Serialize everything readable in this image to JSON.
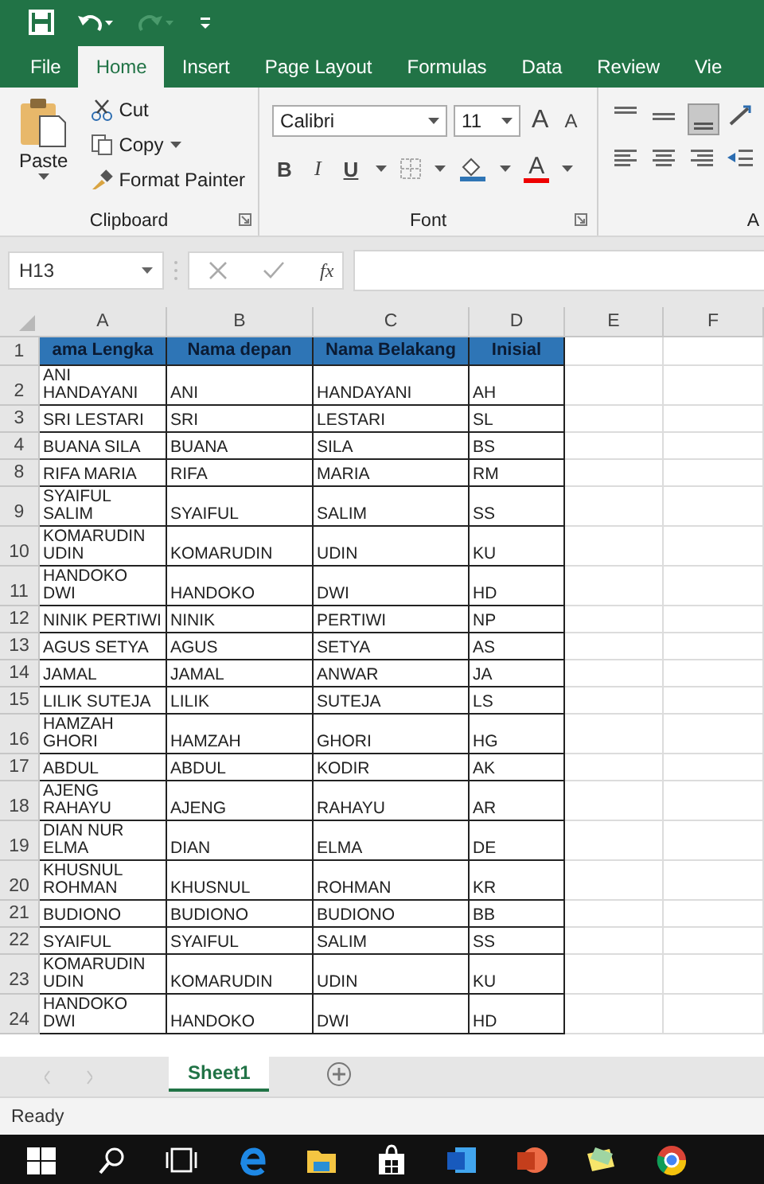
{
  "ribbon_tabs": [
    {
      "label": "File",
      "selected": false
    },
    {
      "label": "Home",
      "selected": true
    },
    {
      "label": "Insert",
      "selected": false
    },
    {
      "label": "Page Layout",
      "selected": false
    },
    {
      "label": "Formulas",
      "selected": false
    },
    {
      "label": "Data",
      "selected": false
    },
    {
      "label": "Review",
      "selected": false
    },
    {
      "label": "Vie",
      "selected": false
    }
  ],
  "clipboard": {
    "paste": "Paste",
    "cut": "Cut",
    "copy": "Copy",
    "format_painter": "Format Painter",
    "group_label": "Clipboard"
  },
  "font": {
    "name": "Calibri",
    "size": "11",
    "grow": "A",
    "shrink": "A",
    "bold": "B",
    "italic": "I",
    "underline": "U",
    "font_color": "A",
    "group_label": "Font"
  },
  "alignment": {
    "group_label": "A"
  },
  "name_box": "H13",
  "function_label": "fx",
  "columns": [
    "A",
    "B",
    "C",
    "D",
    "E",
    "F"
  ],
  "rows": [
    {
      "number": "1",
      "kind": "header",
      "cells": [
        "ama Lengka",
        "Nama depan",
        "Nama Belakang",
        "Inisial"
      ]
    },
    {
      "number": "2",
      "kind": "data",
      "cells": [
        "ANI HANDAYANI",
        "ANI",
        "HANDAYANI",
        "AH"
      ]
    },
    {
      "number": "3",
      "kind": "data",
      "cells": [
        "SRI LESTARI",
        "SRI",
        "LESTARI",
        "SL"
      ]
    },
    {
      "number": "4",
      "kind": "data",
      "cells": [
        "BUANA SILA",
        "BUANA",
        "SILA",
        "BS"
      ]
    },
    {
      "number": "8",
      "kind": "data",
      "cells": [
        "RIFA MARIA",
        "RIFA",
        "MARIA",
        "RM"
      ]
    },
    {
      "number": "9",
      "kind": "data",
      "cells": [
        "SYAIFUL SALIM",
        "SYAIFUL",
        "SALIM",
        "SS"
      ]
    },
    {
      "number": "10",
      "kind": "data",
      "cells": [
        "KOMARUDIN UDIN",
        "KOMARUDIN",
        "UDIN",
        "KU"
      ]
    },
    {
      "number": "11",
      "kind": "data",
      "cells": [
        "HANDOKO DWI",
        "HANDOKO",
        "DWI",
        "HD"
      ]
    },
    {
      "number": "12",
      "kind": "data",
      "cells": [
        "NINIK PERTIWI",
        "NINIK",
        "PERTIWI",
        "NP"
      ]
    },
    {
      "number": "13",
      "kind": "data",
      "cells": [
        "AGUS SETYA",
        "AGUS",
        "SETYA",
        "AS"
      ]
    },
    {
      "number": "14",
      "kind": "data",
      "cells": [
        "JAMAL",
        "JAMAL",
        "ANWAR",
        "JA"
      ]
    },
    {
      "number": "15",
      "kind": "data",
      "cells": [
        "LILIK SUTEJA",
        "LILIK",
        "SUTEJA",
        "LS"
      ]
    },
    {
      "number": "16",
      "kind": "data",
      "cells": [
        "HAMZAH GHORI",
        "HAMZAH",
        "GHORI",
        "HG"
      ]
    },
    {
      "number": "17",
      "kind": "data",
      "cells": [
        "ABDUL",
        "ABDUL",
        "KODIR",
        "AK"
      ]
    },
    {
      "number": "18",
      "kind": "data",
      "cells": [
        "AJENG RAHAYU",
        "AJENG",
        "RAHAYU",
        "AR"
      ]
    },
    {
      "number": "19",
      "kind": "data",
      "cells": [
        "DIAN NUR ELMA",
        "DIAN",
        "ELMA",
        "DE"
      ]
    },
    {
      "number": "20",
      "kind": "data",
      "cells": [
        "KHUSNUL ROHMAN",
        "KHUSNUL",
        "ROHMAN",
        "KR"
      ]
    },
    {
      "number": "21",
      "kind": "data",
      "cells": [
        "BUDIONO",
        "BUDIONO",
        "BUDIONO",
        "BB"
      ]
    },
    {
      "number": "22",
      "kind": "data",
      "cells": [
        "SYAIFUL",
        "SYAIFUL",
        "SALIM",
        "SS"
      ]
    },
    {
      "number": "23",
      "kind": "data",
      "cells": [
        "KOMARUDIN UDIN",
        "KOMARUDIN",
        "UDIN",
        "KU"
      ]
    },
    {
      "number": "24",
      "kind": "data",
      "cells": [
        "HANDOKO DWI",
        "HANDOKO",
        "DWI",
        "HD"
      ]
    }
  ],
  "sheet_tabs": [
    {
      "label": "Sheet1",
      "selected": true
    }
  ],
  "status_bar": "Ready"
}
